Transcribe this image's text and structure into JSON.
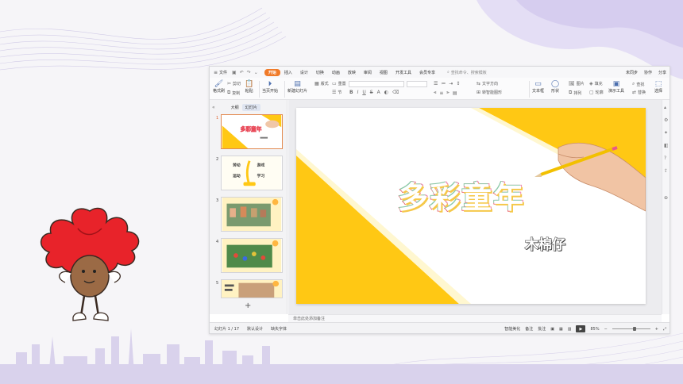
{
  "menubar": {
    "file_label": "文件",
    "tabs": [
      {
        "label": "开始",
        "active": true
      },
      {
        "label": "插入"
      },
      {
        "label": "设计"
      },
      {
        "label": "切换"
      },
      {
        "label": "动画"
      },
      {
        "label": "放映"
      },
      {
        "label": "审阅"
      },
      {
        "label": "视图"
      },
      {
        "label": "开发工具"
      },
      {
        "label": "会员专享"
      }
    ],
    "search_placeholder": "查找命令、搜索模板",
    "right": {
      "sync": "未同步",
      "collab": "协作",
      "share": "分享"
    }
  },
  "ribbon": {
    "format_painter": "格式刷",
    "paste": "粘贴",
    "cut": "剪切",
    "copy": "复制",
    "play_from_current": "当页开始",
    "new_slide": "新建幻灯片",
    "layout": "版式",
    "section": "节",
    "reset": "重置",
    "convert_smartart": "转智能图形",
    "text_box": "文本框",
    "shape": "形状",
    "arrange": "排列",
    "picture": "图片",
    "fill": "填充",
    "outline": "轮廓",
    "presenter_tools": "演示工具",
    "replace": "替换",
    "find": "查找",
    "select": "选择",
    "text_direction": "文字方向"
  },
  "left_panel": {
    "tab_outline": "大纲",
    "tab_slides": "幻灯片",
    "thumbs": [
      {
        "num": "1",
        "title": "多彩童年"
      },
      {
        "num": "2",
        "items": [
          "劳动",
          "运动",
          "游戏",
          "学习"
        ]
      },
      {
        "num": "3"
      },
      {
        "num": "4"
      },
      {
        "num": "5"
      }
    ]
  },
  "slide": {
    "title": "多彩童年",
    "author": "木棉仔"
  },
  "notes_placeholder": "单击此处添加备注",
  "status": {
    "slide_counter": "幻灯片 1 / 17",
    "theme": "默认设计",
    "font_missing": "缺失字体",
    "smart_beautify": "智能美化",
    "notes": "备注",
    "comments": "批注",
    "zoom": "85%"
  },
  "colors": {
    "accent_orange": "#f07a28",
    "slide_yellow": "#ffc814"
  }
}
